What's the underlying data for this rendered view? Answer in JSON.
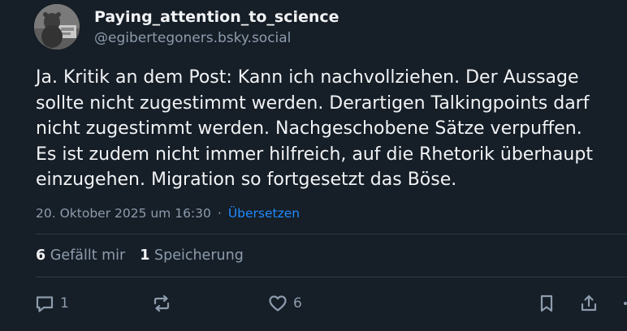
{
  "author": {
    "display_name": "Paying_attention_to_science",
    "handle": "@egibertegoners.bsky.social"
  },
  "post": {
    "text": "Ja. Kritik an dem Post: Kann ich nachvollziehen. Der Aussage\nsollte nicht zugestimmt werden. Derartigen Talkingpoints darf\nnicht zugestimmt werden. Nachgeschobene Sätze verpuffen.\nEs ist zudem nicht immer hilfreich, auf die Rhetorik überhaupt\neinzugehen. Migration so fortgesetzt das Böse.",
    "timestamp": "20. Oktober 2025 um 16:30",
    "separator": "·",
    "translate_label": "Übersetzen"
  },
  "stats": {
    "likes_count": "6",
    "likes_label": "Gefällt mir",
    "saves_count": "1",
    "saves_label": "Speicherung"
  },
  "actions": {
    "reply_count": "1",
    "like_count": "6"
  },
  "icons": {
    "reply": "reply-icon",
    "repost": "repost-icon",
    "like": "heart-icon",
    "bookmark": "bookmark-icon",
    "share": "share-icon"
  },
  "colors": {
    "background": "#161e27",
    "text": "#f1f3f5",
    "muted": "#8d9cad",
    "link": "#208bfe",
    "divider": "#2e3a48"
  }
}
